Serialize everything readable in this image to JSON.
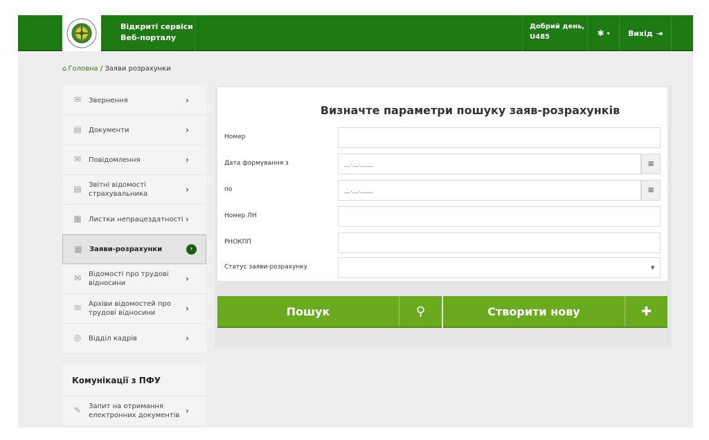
{
  "header": {
    "brand_line1": "Відкриті сервіси",
    "brand_line2": "Веб-порталу",
    "greeting_line1": "Добрий день,",
    "greeting_line2": "U485",
    "settings_icon": "gear-icon",
    "logout_label": "Вихід",
    "logout_icon": "sign-out-icon",
    "color": "#1e7a12"
  },
  "breadcrumb": {
    "home": "Головна",
    "separator": " / ",
    "current": "Заяви розрахунки"
  },
  "sidebar": {
    "items": [
      {
        "label": "Звернення",
        "icon": "envelope-icon"
      },
      {
        "label": "Документи",
        "icon": "document-icon"
      },
      {
        "label": "Повідомлення",
        "icon": "envelope-open-icon"
      },
      {
        "label": "Звітні відомості страхувальника",
        "icon": "document-icon"
      },
      {
        "label": "Листки непрацездатності",
        "icon": "sheet-icon"
      },
      {
        "label": "Заяви-розрахунки",
        "icon": "sheet-icon",
        "active": true
      },
      {
        "label": "Відомості про трудові відносини",
        "icon": "envelope-icon"
      },
      {
        "label": "Архіви відомостей про трудові відносини",
        "icon": "envelope-icon"
      },
      {
        "label": "Відділ кадрів",
        "icon": "circle-icon"
      }
    ],
    "communications": {
      "title": "Комунікації з ПФУ",
      "items": [
        {
          "label": "Запит на отримання електронних документів",
          "icon": "edit-icon"
        }
      ]
    }
  },
  "form": {
    "title": "Визначте параметри пошуку заяв-розрахунків",
    "fields": {
      "number": {
        "label": "Номер",
        "value": ""
      },
      "date_from": {
        "label": "Дата формування з",
        "placeholder": "__.__.____"
      },
      "date_to": {
        "label": "по",
        "placeholder": "__.__.____"
      },
      "ln_number": {
        "label": "Номер ЛН",
        "value": ""
      },
      "rnokpp": {
        "label": "РНОКПП",
        "value": ""
      },
      "status": {
        "label": "Статус заяви-розрахунку",
        "value": ""
      }
    },
    "calendar_icon": "calendar-icon"
  },
  "buttons": {
    "search": {
      "label": "Пошук",
      "icon": "search-icon"
    },
    "create": {
      "label": "Створити нову",
      "icon": "plus-icon"
    },
    "color": "#6aaa1f"
  }
}
